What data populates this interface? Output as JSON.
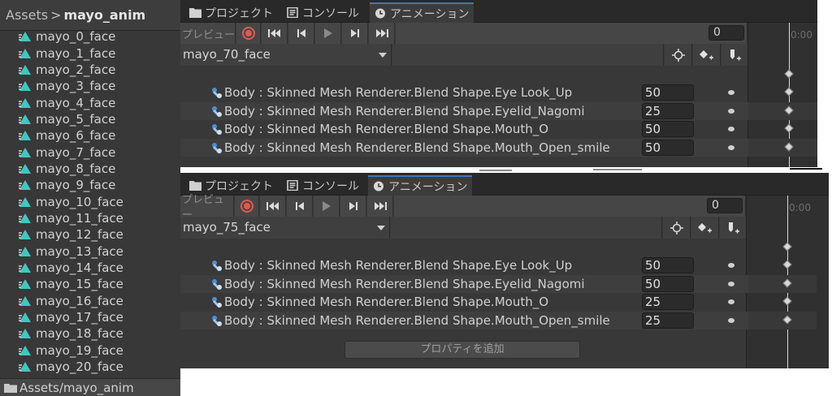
{
  "breadcrumb": {
    "root": "Assets",
    "separator": ">",
    "current": "mayo_anim"
  },
  "assets": [
    "mayo_0_face",
    "mayo_1_face",
    "mayo_2_face",
    "mayo_3_face",
    "mayo_4_face",
    "mayo_5_face",
    "mayo_6_face",
    "mayo_7_face",
    "mayo_8_face",
    "mayo_9_face",
    "mayo_10_face",
    "mayo_11_face",
    "mayo_12_face",
    "mayo_13_face",
    "mayo_14_face",
    "mayo_15_face",
    "mayo_16_face",
    "mayo_17_face",
    "mayo_18_face",
    "mayo_19_face",
    "mayo_20_face"
  ],
  "footer_path": "Assets/mayo_anim",
  "tabs": {
    "project": "プロジェクト",
    "console": "コンソール",
    "animation": "アニメーション"
  },
  "toolbar": {
    "preview": "プレビュー",
    "time_label": "0:00"
  },
  "panel1": {
    "frame": "0",
    "clip": "mayo_70_face",
    "properties": [
      {
        "name": "Body : Skinned Mesh Renderer.Blend Shape.Eye Look_Up",
        "value": "50"
      },
      {
        "name": "Body : Skinned Mesh Renderer.Blend Shape.Eyelid_Nagomi",
        "value": "25"
      },
      {
        "name": "Body : Skinned Mesh Renderer.Blend Shape.Mouth_O",
        "value": "50"
      },
      {
        "name": "Body : Skinned Mesh Renderer.Blend Shape.Mouth_Open_smile",
        "value": "50"
      }
    ]
  },
  "panel2": {
    "frame": "0",
    "clip": "mayo_75_face",
    "properties": [
      {
        "name": "Body : Skinned Mesh Renderer.Blend Shape.Eye Look_Up",
        "value": "50"
      },
      {
        "name": "Body : Skinned Mesh Renderer.Blend Shape.Eyelid_Nagomi",
        "value": "50"
      },
      {
        "name": "Body : Skinned Mesh Renderer.Blend Shape.Mouth_O",
        "value": "25"
      },
      {
        "name": "Body : Skinned Mesh Renderer.Blend Shape.Mouth_Open_smile",
        "value": "25"
      }
    ],
    "add_property": "プロパティを追加"
  },
  "colors": {
    "record": "#e05a4e",
    "tab_accent": "#3a79bb",
    "anim_icon": "#3fc7c0",
    "script_icon": "#4a8fd6"
  }
}
